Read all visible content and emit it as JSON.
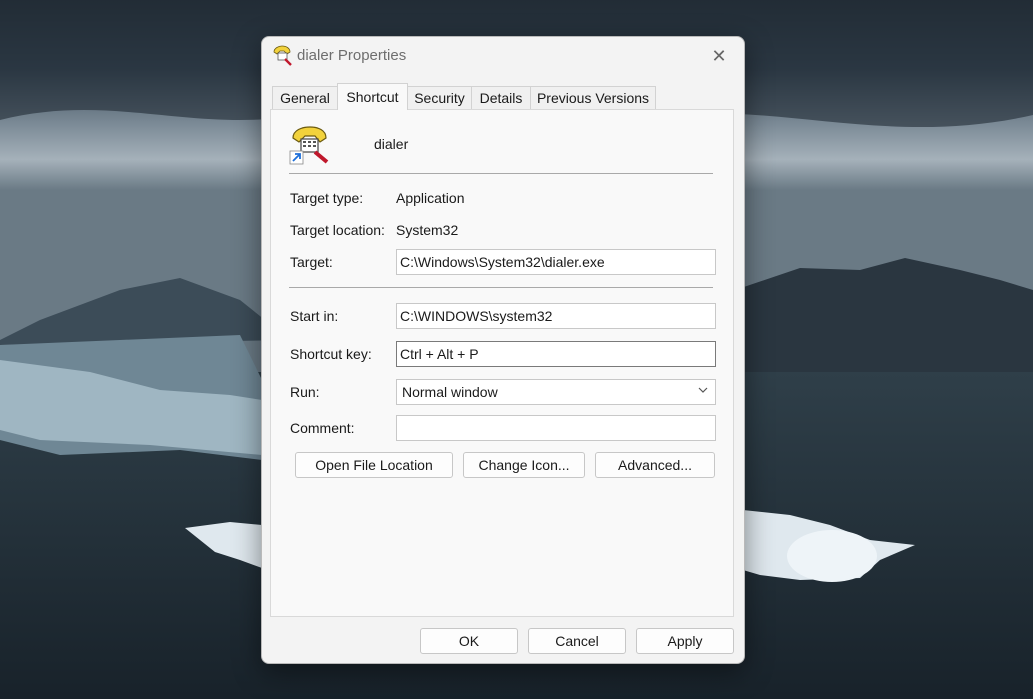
{
  "window": {
    "title": "dialer Properties",
    "close_glyph": "✕"
  },
  "tabs": [
    {
      "label": "General",
      "active": false
    },
    {
      "label": "Shortcut",
      "active": true
    },
    {
      "label": "Security",
      "active": false
    },
    {
      "label": "Details",
      "active": false
    },
    {
      "label": "Previous Versions",
      "active": false
    }
  ],
  "shortcut": {
    "name": "dialer",
    "icon": "phone-dialer-icon",
    "target_type_label": "Target type:",
    "target_type_value": "Application",
    "target_location_label": "Target location:",
    "target_location_value": "System32",
    "target_label": "Target:",
    "target_value": "C:\\Windows\\System32\\dialer.exe",
    "start_in_label": "Start in:",
    "start_in_value": "C:\\WINDOWS\\system32",
    "shortcut_key_label": "Shortcut key:",
    "shortcut_key_value": "Ctrl + Alt + P",
    "run_label": "Run:",
    "run_value": "Normal window",
    "comment_label": "Comment:",
    "comment_value": ""
  },
  "actions": {
    "open_file_location": "Open File Location",
    "change_icon": "Change Icon...",
    "advanced": "Advanced..."
  },
  "footer": {
    "ok": "OK",
    "cancel": "Cancel",
    "apply": "Apply"
  },
  "colors": {
    "dialog_bg": "#f3f3f3",
    "panel_bg": "#f9f9f9",
    "border": "#c8c8c8"
  }
}
